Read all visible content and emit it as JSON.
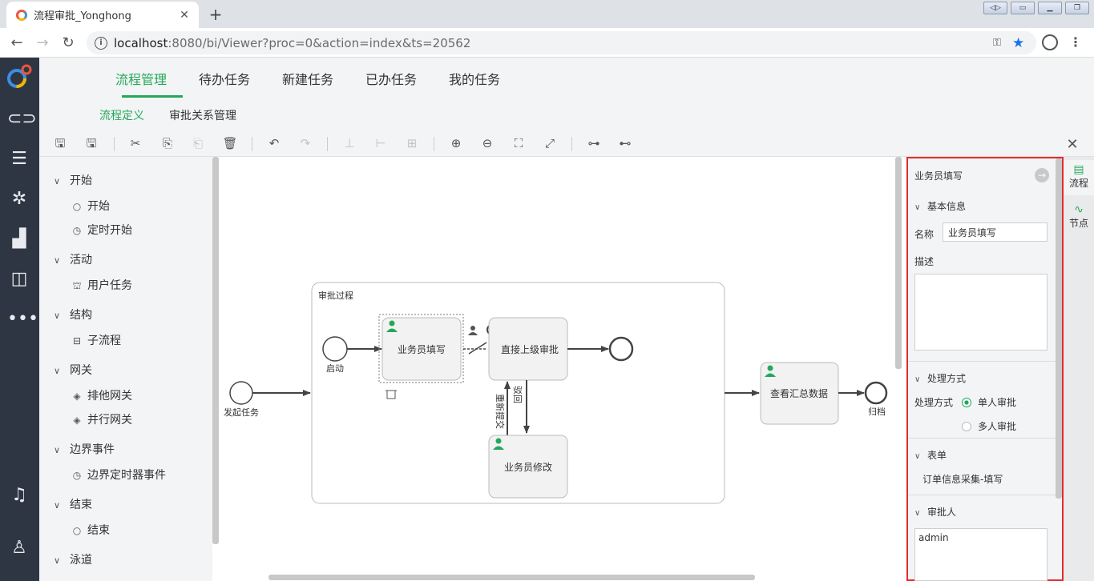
{
  "browser": {
    "tab_title": "流程审批_Yonghong",
    "url_host": "localhost",
    "url_rest": ":8080/bi/Viewer?proc=0&action=index&ts=20562"
  },
  "header": {
    "tabs": [
      {
        "label": "流程管理",
        "active": true
      },
      {
        "label": "待办任务"
      },
      {
        "label": "新建任务"
      },
      {
        "label": "已办任务"
      },
      {
        "label": "我的任务"
      }
    ],
    "subtabs": [
      {
        "label": "流程定义",
        "active": true
      },
      {
        "label": "审批关系管理"
      }
    ]
  },
  "palette": {
    "groups": [
      {
        "label": "开始",
        "items": [
          {
            "label": "开始",
            "icon": "circle-icon"
          },
          {
            "label": "定时开始",
            "icon": "clock-icon"
          }
        ]
      },
      {
        "label": "活动",
        "items": [
          {
            "label": "用户任务",
            "icon": "user-task-icon"
          }
        ]
      },
      {
        "label": "结构",
        "items": [
          {
            "label": "子流程",
            "icon": "subprocess-icon"
          }
        ]
      },
      {
        "label": "网关",
        "items": [
          {
            "label": "排他网关",
            "icon": "exclusive-gateway-icon"
          },
          {
            "label": "并行网关",
            "icon": "parallel-gateway-icon"
          }
        ]
      },
      {
        "label": "边界事件",
        "items": [
          {
            "label": "边界定时器事件",
            "icon": "clock-icon"
          }
        ]
      },
      {
        "label": "结束",
        "items": [
          {
            "label": "结束",
            "icon": "end-circle-icon"
          }
        ]
      },
      {
        "label": "泳道",
        "items": []
      }
    ]
  },
  "diagram": {
    "subprocess_title": "审批过程",
    "start_outer": "发起任务",
    "start_inner": "启动",
    "task_fill": "业务员填写",
    "task_approve": "直接上级审批",
    "task_modify": "业务员修改",
    "task_summary": "查看汇总数据",
    "end_outer": "归档",
    "edge_resubmit": "重新提交",
    "edge_reject": "驳回"
  },
  "panel": {
    "title": "业务员填写",
    "basic_section": "基本信息",
    "name_label": "名称",
    "name_value": "业务员填写",
    "desc_label": "描述",
    "desc_value": "",
    "handling_section": "处理方式",
    "handling_label": "处理方式",
    "option_single": "单人审批",
    "option_multi": "多人审批",
    "selected_option": "单人审批",
    "form_section": "表单",
    "form_value": "订单信息采集-填写",
    "approver_section": "审批人",
    "approver_value": "admin"
  },
  "sidetabs": [
    {
      "label": "流程",
      "icon": "flow-icon",
      "active": true
    },
    {
      "label": "节点",
      "icon": "node-icon"
    }
  ],
  "colors": {
    "accent": "#23a85b",
    "sidebar": "#2f3643",
    "highlight_border": "#e52b2b"
  }
}
